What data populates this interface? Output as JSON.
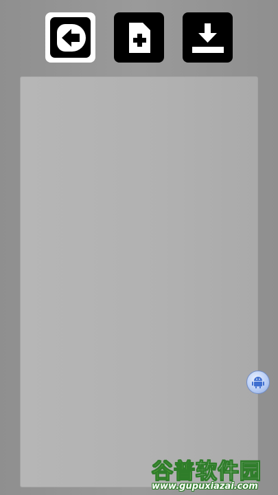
{
  "toolbar": {
    "buttons": [
      {
        "id": "back",
        "icon": "arrow-left-icon",
        "selected": true
      },
      {
        "id": "new",
        "icon": "file-plus-icon",
        "selected": false
      },
      {
        "id": "download",
        "icon": "download-icon",
        "selected": false
      }
    ]
  },
  "floating_button": {
    "icon": "android-icon",
    "color": "#b9cef5"
  },
  "watermark": {
    "title_part1": "谷普",
    "title_part2": "软件园",
    "url": "www.gupuxiazai.com"
  },
  "colors": {
    "background": "#959595",
    "panel": "#b1b1b1",
    "button": "#000000",
    "selected_border": "#ffffff"
  }
}
